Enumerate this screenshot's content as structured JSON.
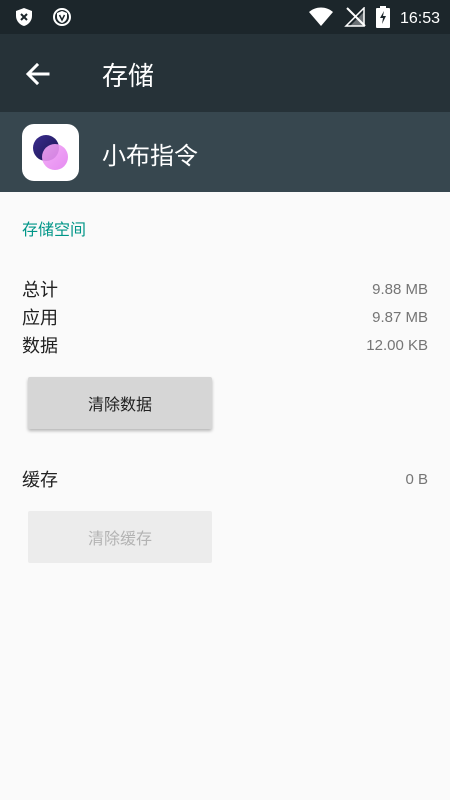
{
  "status_bar": {
    "time": "16:53",
    "left_icons": [
      "shield-x-icon",
      "shield-v-icon"
    ],
    "right_icons": [
      "wifi-icon",
      "no-signal-icon",
      "battery-charging-icon"
    ]
  },
  "toolbar": {
    "title": "存储"
  },
  "app": {
    "name": "小布指令",
    "icon": "app-logo-icon"
  },
  "storage": {
    "section_title": "存储空间",
    "rows": [
      {
        "label": "总计",
        "value": "9.88 MB"
      },
      {
        "label": "应用",
        "value": "9.87 MB"
      },
      {
        "label": "数据",
        "value": "12.00 KB"
      }
    ],
    "clear_data_label": "清除数据"
  },
  "cache": {
    "label": "缓存",
    "value": "0 B",
    "clear_cache_label": "清除缓存"
  },
  "colors": {
    "accent": "#009688",
    "toolbar": "#263238",
    "app_header": "#37474f"
  }
}
